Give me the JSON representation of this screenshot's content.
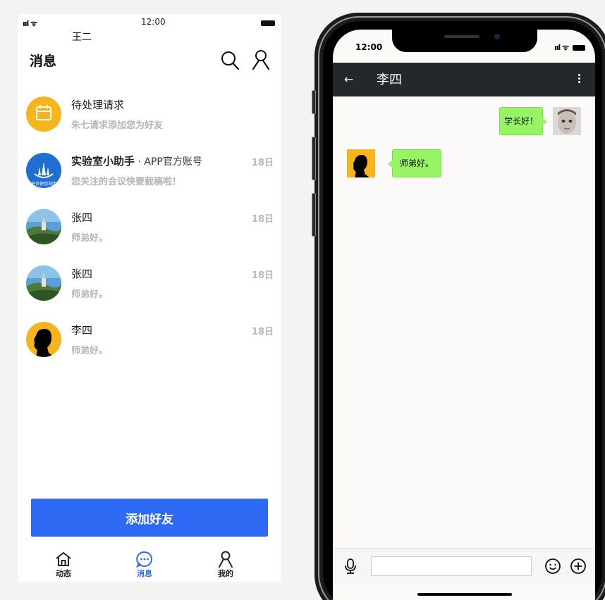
{
  "left": {
    "status": {
      "signal": "ııl ᯤ",
      "time": "12:00"
    },
    "username": "王二",
    "title": "消息",
    "messages": [
      {
        "name": "待处理请求",
        "preview": "朱七请求添加您为好友",
        "date": "",
        "avatar": "calendar"
      },
      {
        "name": "实验室小助手",
        "tag": " · APP官方账号",
        "preview": "您关注的会议快要截稿啦！",
        "date": "18日",
        "avatar": "assistant",
        "avatar_text": "平台使用说明"
      },
      {
        "name": "张四",
        "preview": "师弟好。",
        "date": "18日",
        "avatar": "landscape"
      },
      {
        "name": "张四",
        "preview": "师弟好。",
        "date": "18日",
        "avatar": "landscape"
      },
      {
        "name": "李四",
        "preview": "师弟好。",
        "date": "18日",
        "avatar": "silhouette"
      }
    ],
    "add_button": "添加好友",
    "tabs": [
      {
        "label": "动态",
        "icon": "home-icon"
      },
      {
        "label": "消息",
        "icon": "chat-icon"
      },
      {
        "label": "我的",
        "icon": "user-icon"
      }
    ]
  },
  "phone": {
    "time": "12:00",
    "status": "ııl ᯤ",
    "chat_title": "李四",
    "messages": [
      {
        "side": "right",
        "text": "学长好！"
      },
      {
        "side": "left",
        "text": "师弟好。"
      }
    ]
  },
  "colors": {
    "accent": "#2f6af5",
    "bubble": "#97f565",
    "header": "#23282b",
    "badge_yellow": "#f7b51c"
  }
}
